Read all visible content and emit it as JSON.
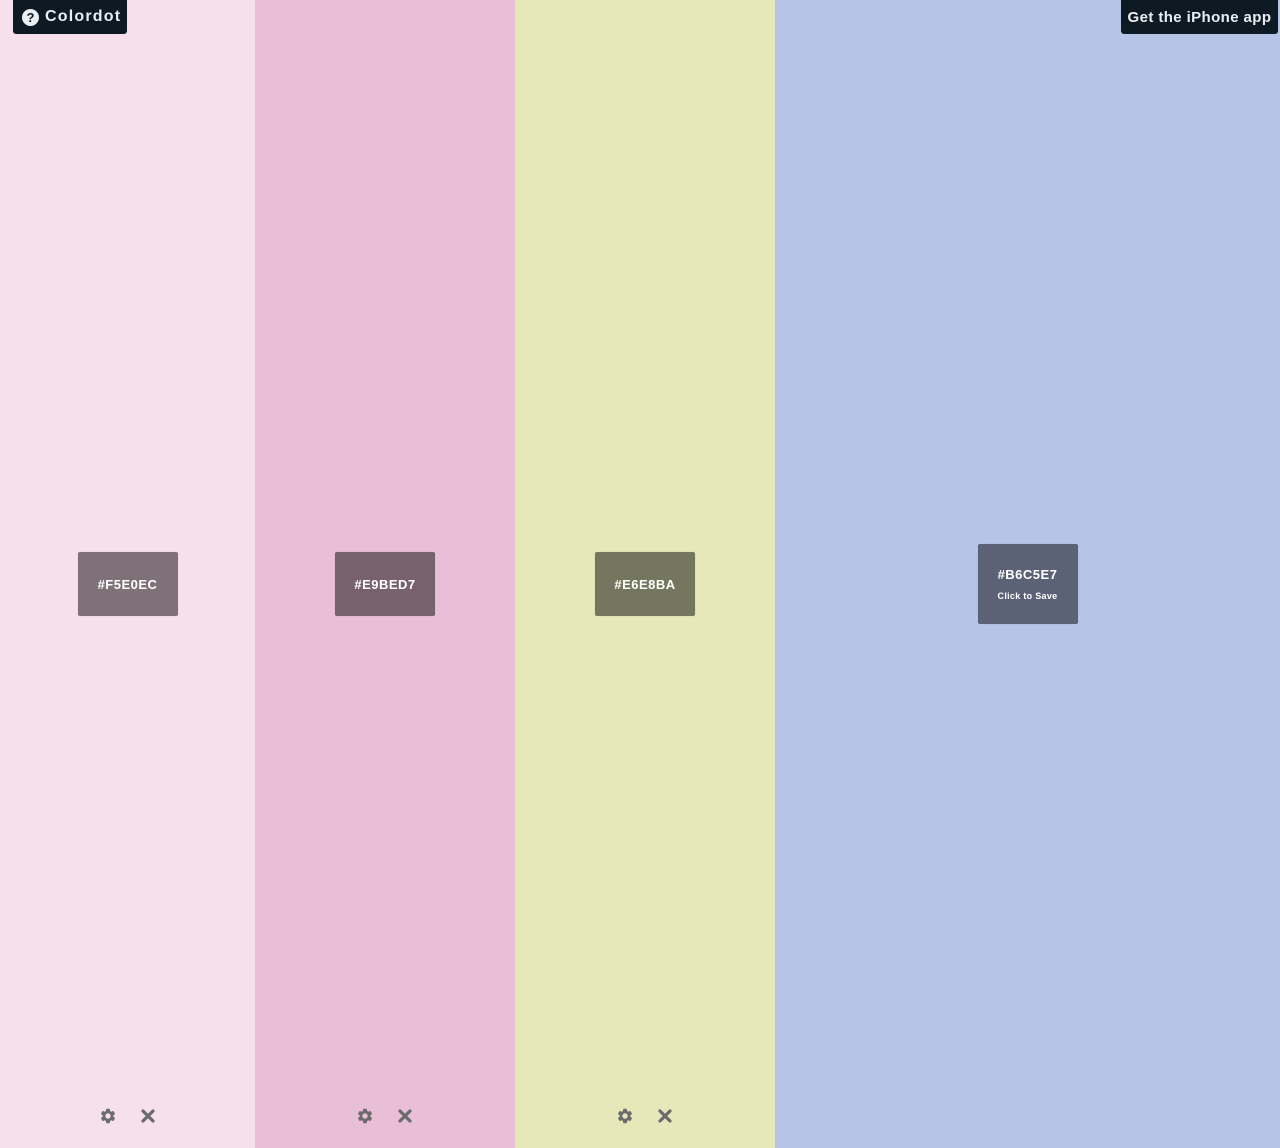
{
  "header": {
    "brand_label": "Colordot",
    "help_icon_glyph": "?",
    "iphone_label": "Get the iPhone app"
  },
  "columns": [
    {
      "color": "#F5E0EC",
      "label": "#F5E0EC",
      "label_bg": "#7E7278"
    },
    {
      "color": "#E9BED7",
      "label": "#E9BED7",
      "label_bg": "#77616D"
    },
    {
      "color": "#E6E8BA",
      "label": "#E6E8BA",
      "label_bg": "#74765E"
    },
    {
      "color": "#B6C5E7",
      "label": "#B6C5E7",
      "label_bg": "#5C6275",
      "hint": "Click to Save"
    }
  ],
  "icons": {
    "settings": "gear-icon",
    "remove": "close-icon",
    "help": "question-circle-icon"
  },
  "colors": {
    "toolbar_bg": "#0D1A24",
    "toolbar_text": "#E9EEF2",
    "tool_icon": "#6B6B6B"
  }
}
